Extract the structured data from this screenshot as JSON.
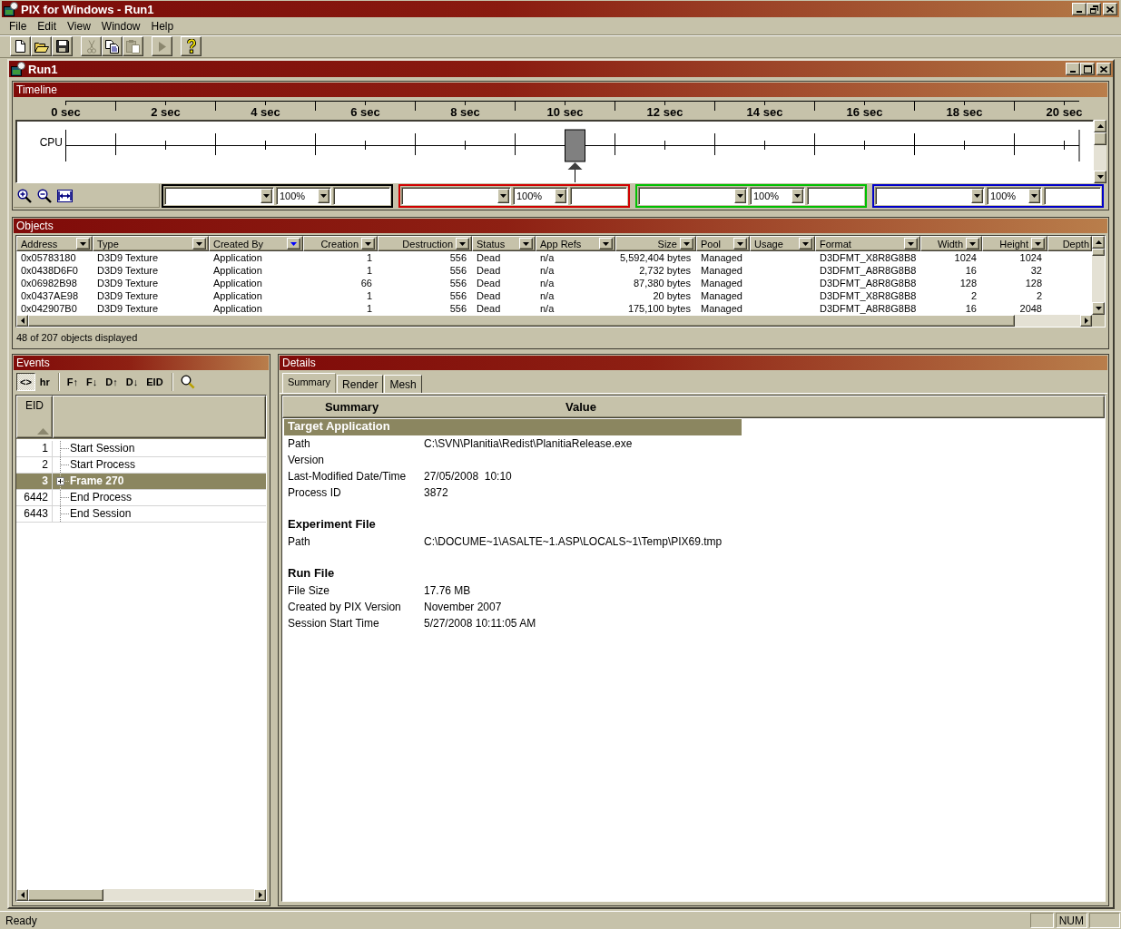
{
  "window": {
    "title": "PIX for Windows - Run1"
  },
  "menu": [
    {
      "label": "File"
    },
    {
      "label": "Edit"
    },
    {
      "label": "View"
    },
    {
      "label": "Window"
    },
    {
      "label": "Help"
    }
  ],
  "toolbar": [
    [
      {
        "kind": "new",
        "disabled": false
      },
      {
        "kind": "open",
        "disabled": false
      },
      {
        "kind": "save",
        "disabled": false
      }
    ],
    [
      {
        "kind": "cut",
        "disabled": true
      },
      {
        "kind": "copy",
        "disabled": false
      },
      {
        "kind": "paste",
        "disabled": true
      }
    ],
    [
      {
        "kind": "run",
        "disabled": true
      }
    ],
    [
      {
        "kind": "help",
        "disabled": false
      }
    ]
  ],
  "document": {
    "title": "Run1"
  },
  "timeline": {
    "title": "Timeline",
    "ticks": [
      "0 sec",
      "2 sec",
      "4 sec",
      "6 sec",
      "8 sec",
      "10 sec",
      "12 sec",
      "14 sec",
      "16 sec",
      "18 sec",
      "20 sec"
    ],
    "tracks": [
      {
        "label": "CPU"
      }
    ],
    "cursor": {
      "level": 0.51
    },
    "counters": [
      {
        "color": "#000000",
        "scale": "100%"
      },
      {
        "color": "#d00000",
        "scale": "100%"
      },
      {
        "color": "#00c000",
        "scale": "100%"
      },
      {
        "color": "#0000c8",
        "scale": "100%"
      }
    ]
  },
  "objects": {
    "title": "Objects",
    "columns": [
      {
        "label": "Address",
        "filtered": false
      },
      {
        "label": "Type",
        "filtered": false
      },
      {
        "label": "Created By",
        "filtered": true
      },
      {
        "label": "Creation",
        "filtered": false
      },
      {
        "label": "Destruction",
        "filtered": false
      },
      {
        "label": "Status",
        "filtered": false
      },
      {
        "label": "App Refs",
        "filtered": false
      },
      {
        "label": "Size",
        "filtered": false
      },
      {
        "label": "Pool",
        "filtered": false
      },
      {
        "label": "Usage",
        "filtered": false
      },
      {
        "label": "Format",
        "filtered": false
      },
      {
        "label": "Width",
        "filtered": false
      },
      {
        "label": "Height",
        "filtered": false
      },
      {
        "label": "Depth"
      }
    ],
    "rows": [
      [
        "0x05783180",
        "D3D9 Texture",
        "Application",
        "1",
        "556",
        "Dead",
        "n/a",
        "5,592,404 bytes",
        "Managed",
        null,
        "D3DFMT_X8R8G8B8",
        "1024",
        "1024"
      ],
      [
        "0x0438D6F0",
        "D3D9 Texture",
        "Application",
        "1",
        "556",
        "Dead",
        "n/a",
        "2,732 bytes",
        "Managed",
        null,
        "D3DFMT_A8R8G8B8",
        "16",
        "32"
      ],
      [
        "0x06982B98",
        "D3D9 Texture",
        "Application",
        "66",
        "556",
        "Dead",
        "n/a",
        "87,380 bytes",
        "Managed",
        null,
        "D3DFMT_A8R8G8B8",
        "128",
        "128"
      ],
      [
        "0x0437AE98",
        "D3D9 Texture",
        "Application",
        "1",
        "556",
        "Dead",
        "n/a",
        "20 bytes",
        "Managed",
        null,
        "D3DFMT_X8R8G8B8",
        "2",
        "2"
      ],
      [
        "0x042907B0",
        "D3D9 Texture",
        "Application",
        "1",
        "556",
        "Dead",
        "n/a",
        "175,100 bytes",
        "Managed",
        null,
        "D3DFMT_A8R8G8B8",
        "16",
        "2048"
      ]
    ],
    "status": "48 of 207 objects displayed"
  },
  "events": {
    "title": "Events",
    "tools": [
      [
        {
          "kind": "text",
          "label": "<>",
          "pressed": true
        },
        {
          "kind": "text",
          "label": "hr",
          "pressed": false
        }
      ],
      [
        {
          "kind": "text",
          "label": "F↑",
          "pressed": false
        },
        {
          "kind": "text",
          "label": "F↓",
          "pressed": false
        },
        {
          "kind": "text",
          "label": "D↑",
          "pressed": false
        },
        {
          "kind": "text",
          "label": "D↓",
          "pressed": false
        },
        {
          "kind": "text",
          "label": "EID",
          "pressed": false
        }
      ],
      [
        {
          "kind": "search",
          "pressed": false
        }
      ]
    ],
    "columns": [
      {
        "label": "EID",
        "sorted": true
      }
    ],
    "rows": [
      {
        "eid": "1",
        "label": "Start Session",
        "expandable": false,
        "selected": false
      },
      {
        "eid": "2",
        "label": "Start Process",
        "expandable": false,
        "selected": false
      },
      {
        "eid": "3",
        "label": "Frame 270",
        "expandable": true,
        "selected": true
      },
      {
        "eid": "6442",
        "label": "End Process",
        "expandable": false,
        "selected": false
      },
      {
        "eid": "6443",
        "label": "End Session",
        "expandable": false,
        "selected": false
      }
    ]
  },
  "details": {
    "title": "Details",
    "tabs": [
      {
        "label": "Summary",
        "selected": true
      },
      {
        "label": "Render",
        "selected": false
      },
      {
        "label": "Mesh",
        "selected": false
      }
    ],
    "columns": [
      "Summary",
      "Value"
    ],
    "sections": [
      {
        "title": "Target Application",
        "selected": true,
        "rows": [
          {
            "name": "Path",
            "value": "C:\\SVN\\Planitia\\Redist\\PlanitiaRelease.exe"
          },
          {
            "name": "Version"
          },
          {
            "name": "Last-Modified Date/Time",
            "value": "27/05/2008  10:10"
          },
          {
            "name": "Process ID",
            "value": "3872"
          }
        ]
      },
      {
        "title": "Experiment File",
        "selected": false,
        "rows": [
          {
            "name": "Path",
            "value": "C:\\DOCUME~1\\ASALTE~1.ASP\\LOCALS~1\\Temp\\PIX69.tmp"
          }
        ]
      },
      {
        "title": "Run File",
        "selected": false,
        "rows": [
          {
            "name": "File Size",
            "value": "17.76 MB"
          },
          {
            "name": "Created by PIX Version",
            "value": "November 2007"
          },
          {
            "name": "Session Start Time",
            "value": "5/27/2008 10:11:05 AM"
          }
        ]
      }
    ]
  },
  "status_bar": {
    "text": "Ready",
    "indicators": [
      {
        "label": "NUM"
      }
    ]
  }
}
